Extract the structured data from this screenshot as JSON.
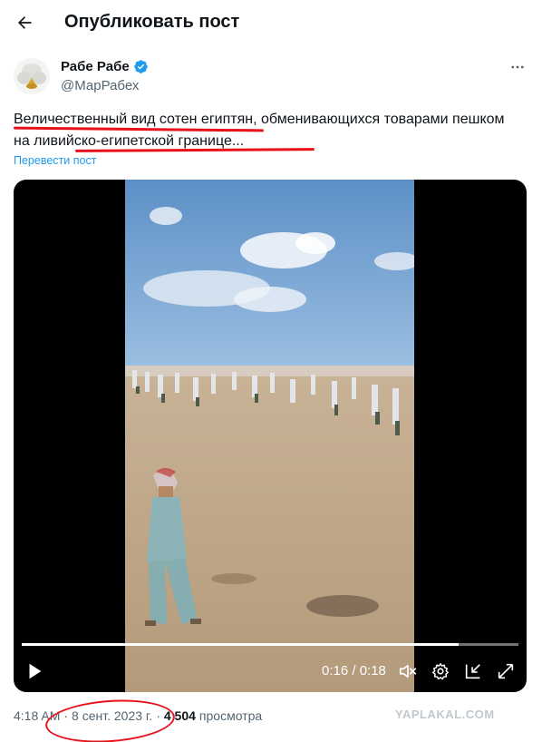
{
  "header": {
    "title": "Опубликовать пост",
    "back_icon": "arrow-left-icon"
  },
  "author": {
    "name": "Рабе Рабе",
    "handle": "@МарРабех",
    "verified_color": "#1d9bf0"
  },
  "post": {
    "text_part1": "Величественный вид сотен египтян,",
    "text_part2": " обменивающихся товарами пешком ",
    "text_part3": "на ливийско-египетской границе",
    "text_part4": "...",
    "translate_label": "Перевести пост"
  },
  "video": {
    "time": "0:16 / 0:18",
    "progress": 0.88,
    "controls": [
      "play-icon",
      "mute-icon",
      "settings-icon",
      "exit-fullscreen-icon",
      "fullscreen-icon"
    ]
  },
  "meta": {
    "time": "4:18 AM",
    "separator": "·",
    "date": "8 сент. 2023 г.",
    "views_count": "4 504",
    "views_label": "просмотра"
  },
  "watermark": "YAPLAKAL.COM",
  "colors": {
    "accent": "#1d9bf0",
    "annotation": "#e8121b",
    "muted": "#536471"
  }
}
